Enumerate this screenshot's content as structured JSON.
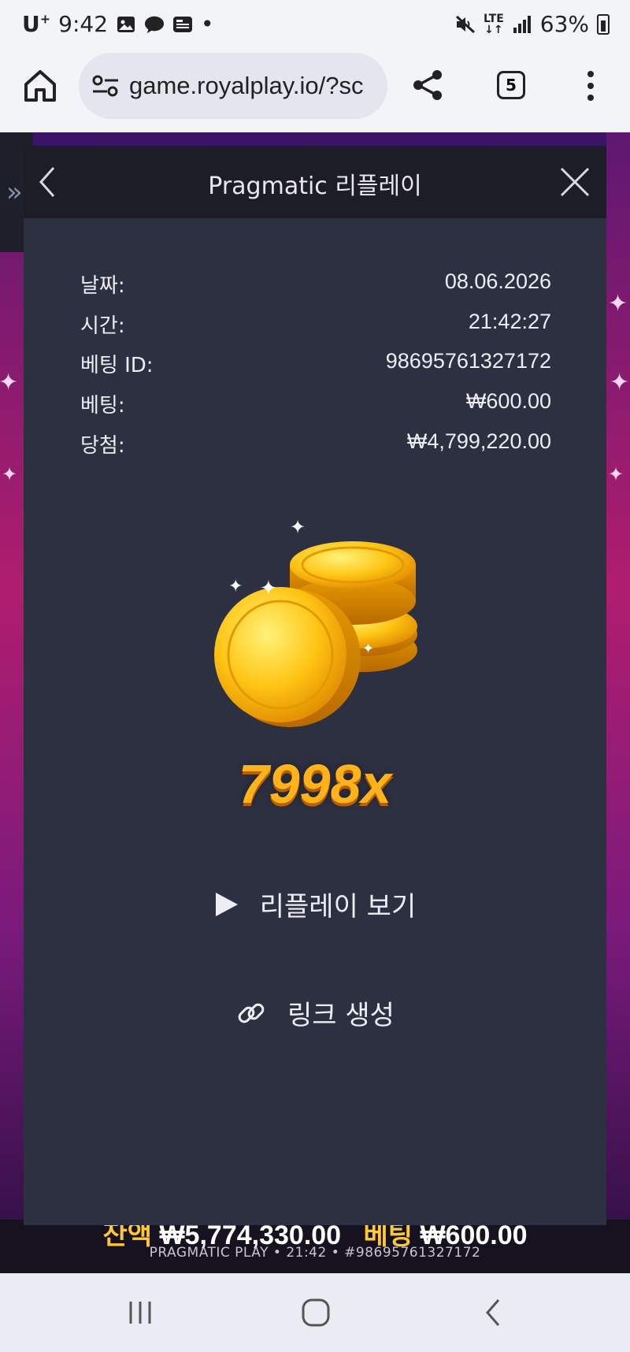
{
  "status_bar": {
    "carrier": "U",
    "carrier_sup": "+",
    "time": "9:42",
    "dot": "•",
    "network": "LTE",
    "battery": "63%"
  },
  "browser": {
    "url": "game.royalplay.io/?sc",
    "tab_count": "5"
  },
  "modal": {
    "title": "Pragmatic 리플레이",
    "rows": [
      {
        "label": "날짜:",
        "value": "08.06.2026"
      },
      {
        "label": "시간:",
        "value": "21:42:27"
      },
      {
        "label": "베팅 ID:",
        "value": "98695761327172"
      },
      {
        "label": "베팅:",
        "value": "₩600.00"
      },
      {
        "label": "당첨:",
        "value": "₩4,799,220.00"
      }
    ],
    "multiplier": "7998x",
    "replay_label": "리플레이 보기",
    "link_label": "링크 생성"
  },
  "game": {
    "balance_label": "잔액",
    "balance_value": "₩5,774,330.00",
    "bet_label": "베팅",
    "bet_value": "₩600.00",
    "footer": "PRAGMATIC PLAY • 21:42 • #98695761327172"
  },
  "colors": {
    "modal_bg": "#2d3040",
    "header_bg": "#1c1d27",
    "gold": "#ffb21a"
  }
}
